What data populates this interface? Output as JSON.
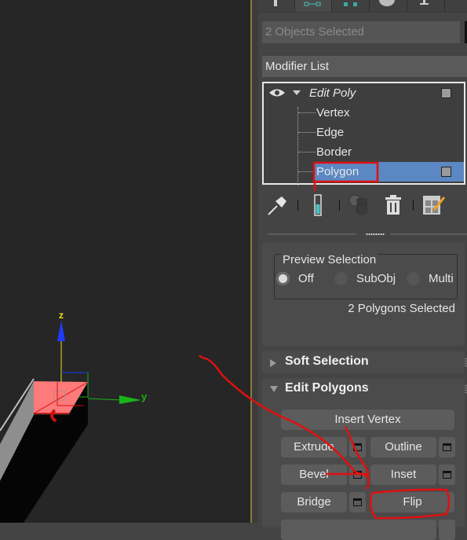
{
  "panel": {
    "tabs": [
      {
        "icon": "create-icon",
        "active": false
      },
      {
        "icon": "modify-icon",
        "active": true
      },
      {
        "icon": "hierarchy-icon",
        "active": false
      },
      {
        "icon": "motion-icon",
        "active": false
      },
      {
        "icon": "display-icon",
        "active": false
      }
    ],
    "object_name_field": "2 Objects Selected",
    "modifier_list_label": "Modifier List",
    "stack": {
      "modifier": "Edit Poly",
      "subobjects": [
        "Vertex",
        "Edge",
        "Border",
        "Polygon"
      ],
      "selected_subobject": "Polygon"
    },
    "stack_toolbar": [
      "pin-stack-icon",
      "show-end-result-icon",
      "make-unique-icon",
      "remove-modifier-icon",
      "configure-modifier-sets-icon"
    ]
  },
  "selection_rollout": {
    "preview_selection_title": "Preview Selection",
    "options": [
      "Off",
      "SubObj",
      "Multi"
    ],
    "selected_option": "Off",
    "status_text": "2 Polygons Selected"
  },
  "soft_selection": {
    "title": "Soft Selection",
    "expanded": false
  },
  "edit_polygons": {
    "title": "Edit Polygons",
    "expanded": true,
    "insert_vertex": "Insert Vertex",
    "buttons": {
      "extrude": "Extrude",
      "outline": "Outline",
      "bevel": "Bevel",
      "inset": "Inset",
      "bridge": "Bridge",
      "flip": "Flip"
    }
  },
  "viewport": {
    "axis_labels": {
      "z": "z",
      "y": "y"
    },
    "colors": {
      "selected_face": "#ff7a7a",
      "z_axis": "#1e3cff",
      "y_axis": "#19b319",
      "x_axis": "#cc1111",
      "axis_label": "#f0e020"
    }
  },
  "annotations": {
    "color": "#e01010"
  }
}
